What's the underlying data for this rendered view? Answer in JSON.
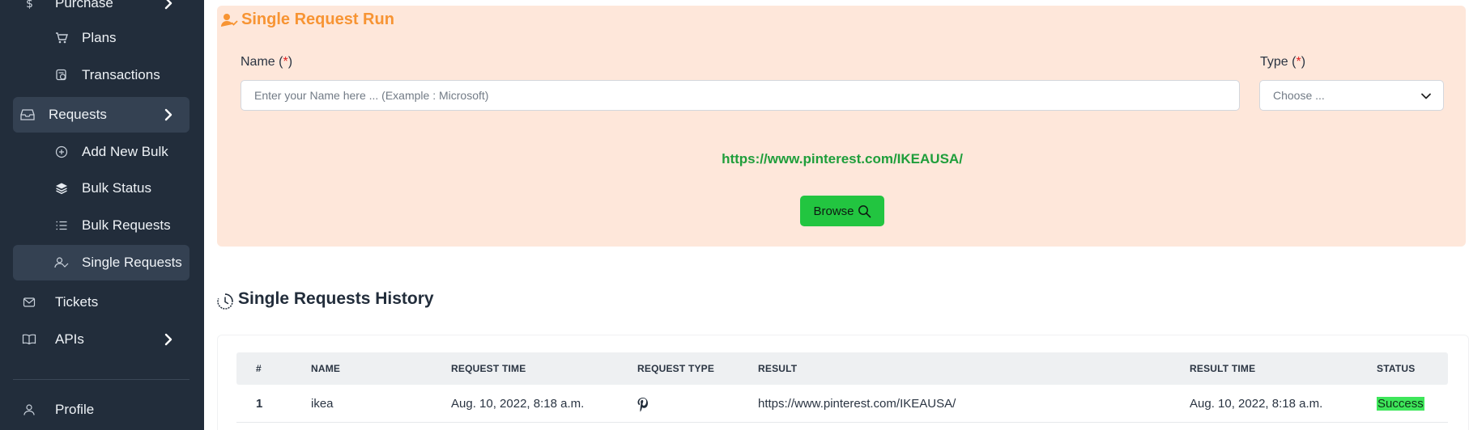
{
  "sidebar": {
    "items": [
      {
        "label": "Purchase",
        "icon": "dollar-icon"
      },
      {
        "label": "Plans",
        "icon": "cart-icon"
      },
      {
        "label": "Transactions",
        "icon": "receipt-icon"
      },
      {
        "label": "Requests",
        "icon": "inbox-icon"
      },
      {
        "label": "Add New Bulk",
        "icon": "plus-circle-icon"
      },
      {
        "label": "Bulk Status",
        "icon": "layers-icon"
      },
      {
        "label": "Bulk Requests",
        "icon": "list-icon"
      },
      {
        "label": "Single Requests",
        "icon": "user-check-icon"
      },
      {
        "label": "Tickets",
        "icon": "mail-icon"
      },
      {
        "label": "APIs",
        "icon": "book-icon"
      },
      {
        "label": "Profile",
        "icon": "user-icon"
      }
    ]
  },
  "form": {
    "title": "Single Request Run",
    "name_label": "Name (",
    "name_label_end": ")",
    "required_mark": "*",
    "name_placeholder": "Enter your Name here ... (Example : Microsoft)",
    "type_label": "Type (",
    "type_label_end": ")",
    "type_value": "Choose ...",
    "result_url": "https://www.pinterest.com/IKEAUSA/",
    "browse_label": "Browse"
  },
  "history": {
    "title": "Single Requests History",
    "columns": [
      "#",
      "NAME",
      "REQUEST TIME",
      "REQUEST TYPE",
      "RESULT",
      "RESULT TIME",
      "STATUS"
    ],
    "rows": [
      {
        "index": "1",
        "name": "ikea",
        "request_time": "Aug. 10, 2022, 8:18 a.m.",
        "request_type_icon": "pinterest-icon",
        "result": "https://www.pinterest.com/IKEAUSA/",
        "result_time": "Aug. 10, 2022, 8:18 a.m.",
        "status": "Success"
      }
    ]
  },
  "colors": {
    "sidebar_bg": "#222d3b",
    "panel_bg": "#fee7da",
    "title_orange": "#f79433",
    "link_green": "#1f9e3b",
    "button_green": "#22c540",
    "status_green": "#3ee65a"
  }
}
